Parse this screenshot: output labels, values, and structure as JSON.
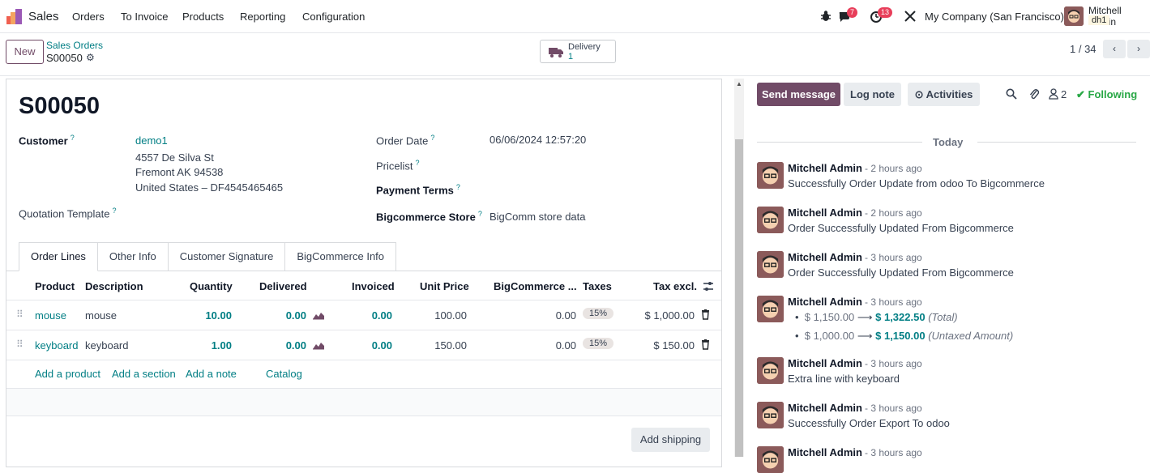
{
  "navbar": {
    "app_name": "Sales",
    "menu": [
      "Orders",
      "To Invoice",
      "Products",
      "Reporting",
      "Configuration"
    ],
    "messages_count": "7",
    "activities_count": "13",
    "company": "My Company (San Francisco)",
    "user_name": "Mitchell Admin",
    "user_db": "dh1"
  },
  "control_panel": {
    "new_label": "New",
    "breadcrumb_parent": "Sales Orders",
    "breadcrumb_current": "S00050",
    "delivery_label": "Delivery",
    "delivery_count": "1",
    "pager": "1 / 34"
  },
  "form": {
    "order_name": "S00050",
    "customer_label": "Customer",
    "customer_name": "demo1",
    "customer_address1": "4557 De Silva St",
    "customer_address2": "Fremont AK 94538",
    "customer_address3": "United States – DF4545465465",
    "quotation_template_label": "Quotation Template",
    "order_date_label": "Order Date",
    "order_date": "06/06/2024 12:57:20",
    "pricelist_label": "Pricelist",
    "payment_terms_label": "Payment Terms",
    "bigcommerce_store_label": "Bigcommerce Store",
    "bigcommerce_store": "BigComm store data"
  },
  "tabs": [
    "Order Lines",
    "Other Info",
    "Customer Signature",
    "BigCommerce Info"
  ],
  "lines": {
    "headers": [
      "Product",
      "Description",
      "Quantity",
      "Delivered",
      "Invoiced",
      "Unit Price",
      "BigCommerce ...",
      "Taxes",
      "Tax excl."
    ],
    "rows": [
      {
        "product": "mouse",
        "description": "mouse",
        "quantity": "10.00",
        "delivered": "0.00",
        "invoiced": "0.00",
        "unit_price": "100.00",
        "bigcommerce": "0.00",
        "taxes": "15%",
        "subtotal": "$ 1,000.00"
      },
      {
        "product": "keyboard",
        "description": "keyboard",
        "quantity": "1.00",
        "delivered": "0.00",
        "invoiced": "0.00",
        "unit_price": "150.00",
        "bigcommerce": "0.00",
        "taxes": "15%",
        "subtotal": "$ 150.00"
      }
    ],
    "add_product": "Add a product",
    "add_section": "Add a section",
    "add_note": "Add a note",
    "catalog": "Catalog",
    "add_shipping": "Add shipping"
  },
  "chatter": {
    "send_message": "Send message",
    "log_note": "Log note",
    "activities": "Activities",
    "followers_count": "2",
    "following": "Following",
    "today": "Today",
    "messages": [
      {
        "author": "Mitchell Admin",
        "time": "- 2 hours ago",
        "body": "Successfully Order Update from odoo To Bigcommerce"
      },
      {
        "author": "Mitchell Admin",
        "time": "- 2 hours ago",
        "body": "Order Successfully Updated From Bigcommerce"
      },
      {
        "author": "Mitchell Admin",
        "time": "- 3 hours ago",
        "body": "Order Successfully Updated From Bigcommerce"
      },
      {
        "author": "Mitchell Admin",
        "time": "- 3 hours ago",
        "body": ""
      },
      {
        "author": "Mitchell Admin",
        "time": "- 3 hours ago",
        "body": "Extra line with keyboard"
      },
      {
        "author": "Mitchell Admin",
        "time": "- 3 hours ago",
        "body": "Successfully Order Export To odoo"
      },
      {
        "author": "Mitchell Admin",
        "time": "- 3 hours ago",
        "body": ""
      }
    ],
    "tracking": [
      {
        "old": "$ 1,150.00",
        "new": "$ 1,322.50",
        "field": "(Total)"
      },
      {
        "old": "$ 1,000.00",
        "new": "$ 1,150.00",
        "field": "(Untaxed Amount)"
      }
    ]
  },
  "colors": {
    "brand": "#714b67",
    "link": "#017e84",
    "following": "#28a745",
    "badge": "#e83e5a"
  }
}
